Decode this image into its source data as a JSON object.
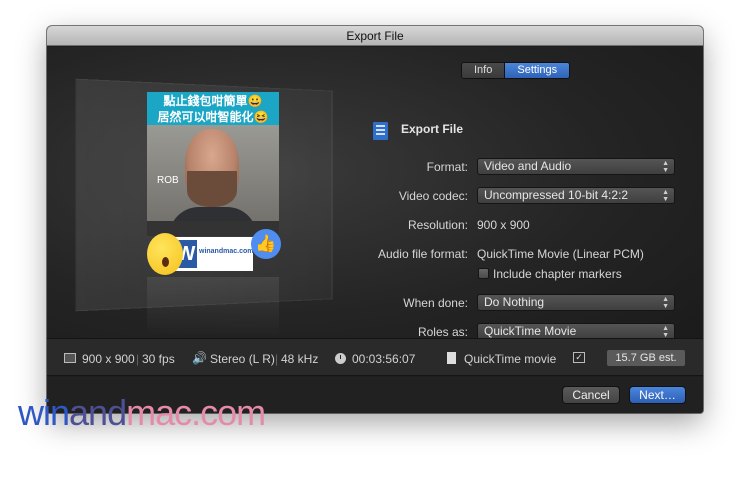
{
  "window": {
    "title": "Export File"
  },
  "tabs": [
    {
      "label": "Info",
      "active": false
    },
    {
      "label": "Settings",
      "active": true
    }
  ],
  "preview": {
    "banner_line1": "點止錢包咁簡單😀",
    "banner_line2": "居然可以咁智能化😆",
    "name_tag": "ROB",
    "strip_text": "winandmac.com"
  },
  "settings": {
    "heading": "Export File",
    "format_label": "Format:",
    "format_value": "Video and Audio",
    "codec_label": "Video codec:",
    "codec_value": "Uncompressed 10-bit 4:2:2",
    "resolution_label": "Resolution:",
    "resolution_value": "900 x 900",
    "audio_label": "Audio file format:",
    "audio_value": "QuickTime Movie (Linear PCM)",
    "chapter_label": "Include chapter markers",
    "chapter_checked": false,
    "done_label": "When done:",
    "done_value": "Do Nothing",
    "roles_label": "Roles as:",
    "roles_value": "QuickTime Movie"
  },
  "info_bar": {
    "video": "900 x 900",
    "fps": "30 fps",
    "audio": "Stereo (L R)",
    "rate": "48 kHz",
    "duration": "00:03:56:07",
    "file_type": "QuickTime movie",
    "size": "15.7 GB est."
  },
  "buttons": {
    "cancel": "Cancel",
    "next": "Next…"
  },
  "watermark": {
    "part1": "win",
    "part2": "and",
    "part3": "mac.com"
  }
}
